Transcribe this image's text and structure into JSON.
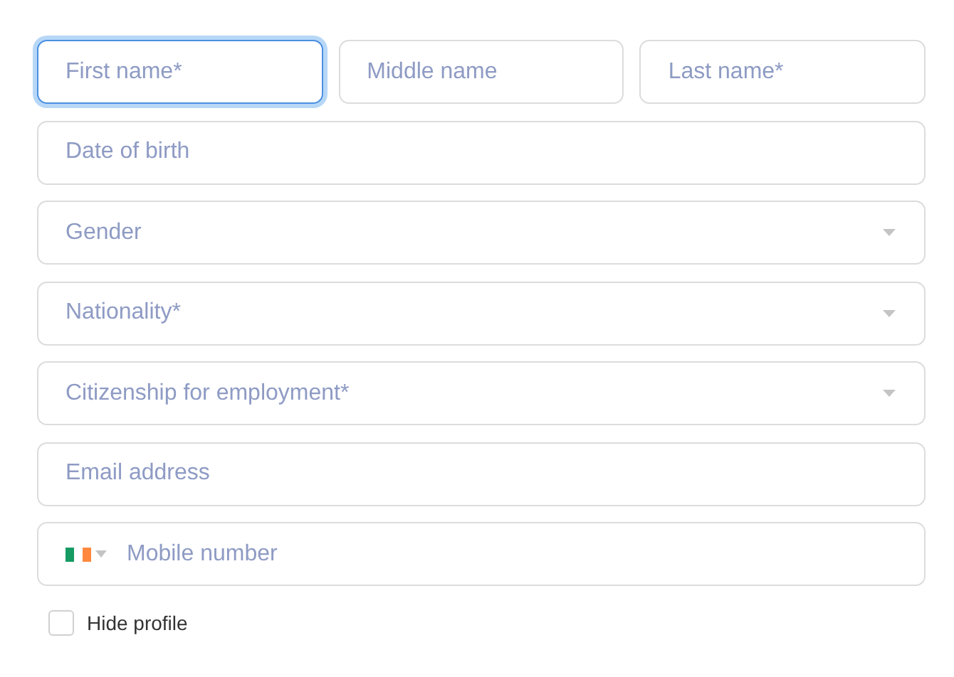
{
  "name_fields": [
    {
      "placeholder": "First name*",
      "focused": true
    },
    {
      "placeholder": "Middle name",
      "focused": false
    },
    {
      "placeholder": "Last name*",
      "focused": false
    }
  ],
  "fields": [
    {
      "kind": "text",
      "placeholder": "Date of birth"
    },
    {
      "kind": "select",
      "placeholder": "Gender"
    },
    {
      "kind": "select",
      "placeholder": "Nationality*"
    },
    {
      "kind": "select",
      "placeholder": "Citizenship for employment*"
    },
    {
      "kind": "text",
      "placeholder": "Email address"
    },
    {
      "kind": "phone",
      "placeholder": "Mobile number"
    }
  ],
  "hide_profile": {
    "label": "Hide profile",
    "checked": false
  }
}
